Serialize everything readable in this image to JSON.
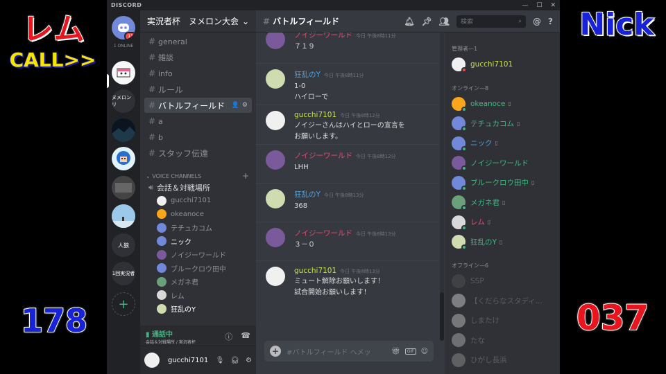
{
  "overlay": {
    "left_name": "レム",
    "call": "CALL>>",
    "right_name": "Nick",
    "left_score": "178",
    "right_score": "037"
  },
  "app": {
    "logo": "DISCORD"
  },
  "colors": {
    "online": "#43b581",
    "dnd": "#f04747",
    "idle": "#faa61a",
    "blurple": "#7289da"
  },
  "servers": {
    "home_badge": "11",
    "online_label": "1 ONLINE",
    "items": [
      {
        "label": ""
      },
      {
        "label": "ヌメロンリ"
      },
      {
        "label": ""
      },
      {
        "label": ""
      },
      {
        "label": ""
      },
      {
        "label": ""
      },
      {
        "label": "人狼"
      },
      {
        "label": "1回実況者"
      }
    ],
    "add_label": "+"
  },
  "guild": {
    "name": "実況者杯　ヌメロン大会"
  },
  "channels": {
    "text": [
      {
        "name": "general"
      },
      {
        "name": "雑談"
      },
      {
        "name": "info"
      },
      {
        "name": "ルール"
      },
      {
        "name": "バトルフィールド"
      },
      {
        "name": "a"
      },
      {
        "name": "b"
      },
      {
        "name": "スタッフ伝達"
      }
    ],
    "voice_category": "VOICE CHANNELS",
    "voice_channel": "会話＆対戦場所",
    "voice_users": [
      {
        "name": "gucchi7101",
        "color": "#f0f0f0"
      },
      {
        "name": "okeanoce",
        "color": "#faa61a"
      },
      {
        "name": "テチュカコム",
        "color": "#7289da"
      },
      {
        "name": "ニック",
        "color": "#7289da"
      },
      {
        "name": "ノイジーワールド",
        "color": "#7a5a9a"
      },
      {
        "name": "ブルークロウ田中",
        "color": "#7289da"
      },
      {
        "name": "メガネ君",
        "color": "#6aa07a"
      },
      {
        "name": "レム",
        "color": "#d8d8d8"
      },
      {
        "name": "狂乱のY",
        "color": "#cfdcb0"
      }
    ]
  },
  "voice_panel": {
    "status": "通話中",
    "location": "会話＆対戦場所 / 実況者杯"
  },
  "user_panel": {
    "username": "gucchi7101"
  },
  "chat": {
    "channel": "バトルフィールド",
    "search_placeholder": "検索",
    "messages": [
      {
        "author": "ノイジーワールド",
        "author_color": "#e94b6f",
        "time": "今日 午後8時11分",
        "lines": [
          "７１９"
        ],
        "avatar": "#7a5a9a"
      },
      {
        "author": "狂乱のY",
        "author_color": "#4fa3e0",
        "time": "今日 午後8時11分",
        "lines": [
          "1-0",
          "ハイローで"
        ],
        "avatar": "#cfdcb0"
      },
      {
        "author": "gucchi7101",
        "author_color": "#c8e04a",
        "time": "今日 午後8時12分",
        "lines": [
          "ノイジーさんはハイとローの宣言を",
          "お願いします。"
        ],
        "avatar": "#f0f0f0"
      },
      {
        "author": "ノイジーワールド",
        "author_color": "#e94b6f",
        "time": "今日 午後8時12分",
        "lines": [
          "LHH"
        ],
        "avatar": "#7a5a9a"
      },
      {
        "author": "狂乱のY",
        "author_color": "#4fa3e0",
        "time": "今日 午後8時13分",
        "lines": [
          "368"
        ],
        "avatar": "#cfdcb0"
      },
      {
        "author": "ノイジーワールド",
        "author_color": "#e94b6f",
        "time": "今日 午後8時13分",
        "lines": [
          "３－０"
        ],
        "avatar": "#7a5a9a"
      },
      {
        "author": "gucchi7101",
        "author_color": "#c8e04a",
        "time": "今日 午後8時13分",
        "lines": [
          "ミュート解除お願いします！",
          "試合開始お願いします！"
        ],
        "avatar": "#f0f0f0"
      }
    ],
    "composer_placeholder": "#バトルフィールド へメッ",
    "gif_label": "GIF"
  },
  "members": {
    "admin_header": "管理者—1",
    "admins": [
      {
        "name": "gucchi7101",
        "color": "#c8e04a",
        "avatar": "#f0f0f0",
        "status": "#f04747"
      }
    ],
    "online_header": "オンライン—8",
    "online": [
      {
        "name": "okeanoce",
        "color": "#43b581",
        "avatar": "#faa61a",
        "status": "#43b581",
        "mobile": true
      },
      {
        "name": "テチュカコム",
        "color": "#43b581",
        "avatar": "#7289da",
        "status": "#43b581",
        "mobile": true
      },
      {
        "name": "ニック",
        "color": "#4fa3e0",
        "avatar": "#7289da",
        "status": "#43b581",
        "mobile": true
      },
      {
        "name": "ノイジーワールド",
        "color": "#43b581",
        "avatar": "#7a5a9a",
        "status": "#43b581",
        "mobile": false
      },
      {
        "name": "ブルークロウ田中",
        "color": "#43b581",
        "avatar": "#7289da",
        "status": "#43b581",
        "mobile": true
      },
      {
        "name": "メガネ君",
        "color": "#43b581",
        "avatar": "#6aa07a",
        "status": "#43b581",
        "mobile": true
      },
      {
        "name": "レム",
        "color": "#e94b6f",
        "avatar": "#d8d8d8",
        "status": "#43b581",
        "mobile": true
      },
      {
        "name": "狂乱のY",
        "color": "#43b581",
        "avatar": "#cfdcb0",
        "status": "#43b581",
        "mobile": true
      }
    ],
    "offline_header": "オフライン—6",
    "offline": [
      {
        "name": "SSP",
        "color": "#8e9297",
        "avatar": "#555"
      },
      {
        "name": "【くだらなスタディ...",
        "color": "#8e9297",
        "avatar": "#ddd"
      },
      {
        "name": "しまたけ",
        "color": "#8e9297",
        "avatar": "#ccc"
      },
      {
        "name": "たな",
        "color": "#8e9297",
        "avatar": "#bbb"
      },
      {
        "name": "ひがし長浜",
        "color": "#8e9297",
        "avatar": "#999"
      }
    ]
  }
}
